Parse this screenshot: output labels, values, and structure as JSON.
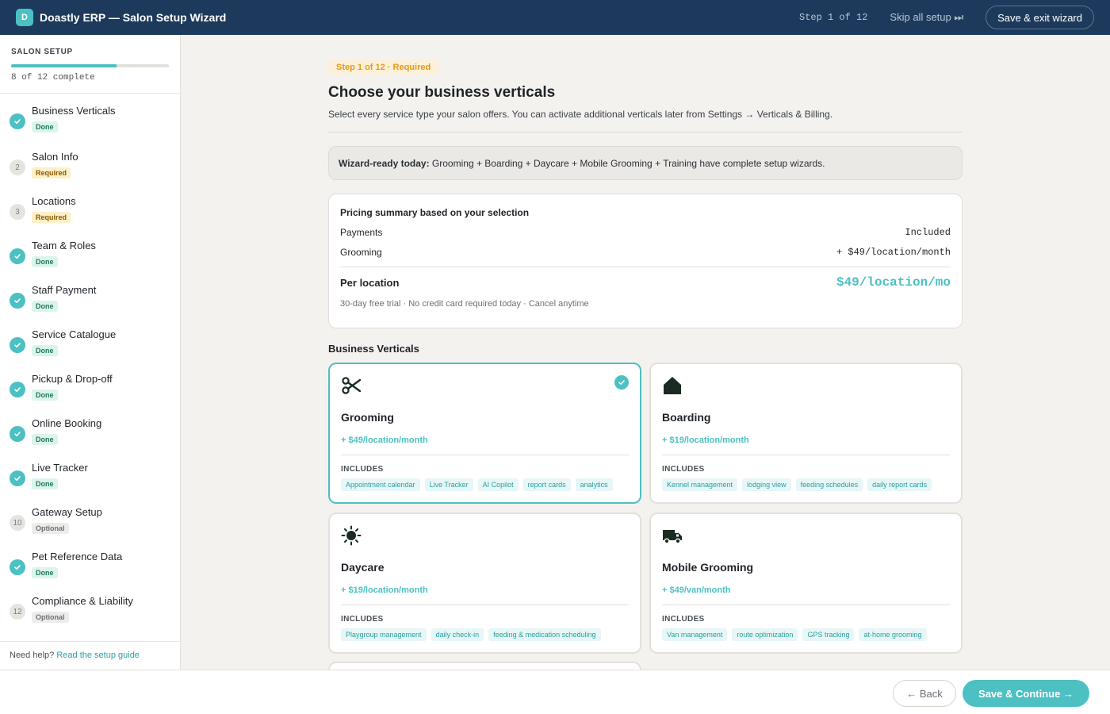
{
  "app": {
    "logo_letter": "D",
    "title": "Doastly ERP — Salon Setup Wizard",
    "step_indicator": "Step 1 of 12",
    "skip_label": "Skip all setup ⏭",
    "exit_label": "Save & exit wizard"
  },
  "sidebar": {
    "title": "SALON SETUP",
    "progress_fraction": 0.67,
    "progress_text": "8 of 12 complete",
    "items": [
      {
        "number": "1",
        "label": "Business Verticals",
        "status": "Done",
        "state": "done"
      },
      {
        "number": "2",
        "label": "Salon Info",
        "status": "Required",
        "state": "required"
      },
      {
        "number": "3",
        "label": "Locations",
        "status": "Required",
        "state": "required"
      },
      {
        "number": "4",
        "label": "Team & Roles",
        "status": "Done",
        "state": "done"
      },
      {
        "number": "5",
        "label": "Staff Payment",
        "status": "Done",
        "state": "done"
      },
      {
        "number": "6",
        "label": "Service Catalogue",
        "status": "Done",
        "state": "done"
      },
      {
        "number": "7",
        "label": "Pickup & Drop-off",
        "status": "Done",
        "state": "done"
      },
      {
        "number": "8",
        "label": "Online Booking",
        "status": "Done",
        "state": "done"
      },
      {
        "number": "9",
        "label": "Live Tracker",
        "status": "Done",
        "state": "done"
      },
      {
        "number": "10",
        "label": "Gateway Setup",
        "status": "Optional",
        "state": "optional"
      },
      {
        "number": "11",
        "label": "Pet Reference Data",
        "status": "Done",
        "state": "done"
      },
      {
        "number": "12",
        "label": "Compliance & Liability",
        "status": "Optional",
        "state": "optional"
      }
    ],
    "help_text": "Need help?",
    "help_link": "Read the setup guide"
  },
  "main": {
    "step_pill": "Step 1 of 12 · Required",
    "title": "Choose your business verticals",
    "subtitle": "Select every service type your salon offers. You can activate additional verticals later from Settings → Verticals & Billing.",
    "notice_bold": "Wizard-ready today:",
    "notice_text": " Grooming + Boarding + Daycare + Mobile Grooming + Training have complete setup wizards.",
    "pricing": {
      "title": "Pricing summary based on your selection",
      "rows": [
        {
          "label": "Payments",
          "value": "Included"
        },
        {
          "label": "Grooming",
          "value": "+ $49/location/month"
        }
      ],
      "total_label": "Per location",
      "total_value": "$49/location/mo",
      "note": "30-day free trial · No credit card required today · Cancel anytime"
    },
    "verticals_title": "Business Verticals",
    "includes_label": "INCLUDES",
    "verticals": [
      {
        "name": "Grooming",
        "price": "+ $49/location/month",
        "icon": "scissors-icon",
        "selected": true,
        "tags": [
          "Appointment calendar",
          "Live Tracker",
          "AI Copilot",
          "report cards",
          "analytics"
        ]
      },
      {
        "name": "Boarding",
        "price": "+ $19/location/month",
        "icon": "house-icon",
        "selected": false,
        "tags": [
          "Kennel management",
          "lodging view",
          "feeding schedules",
          "daily report cards"
        ]
      },
      {
        "name": "Daycare",
        "price": "+ $19/location/month",
        "icon": "sun-icon",
        "selected": false,
        "tags": [
          "Playgroup management",
          "daily check-in",
          "feeding & medication scheduling"
        ]
      },
      {
        "name": "Mobile Grooming",
        "price": "+ $49/van/month",
        "icon": "van-icon",
        "selected": false,
        "tags": [
          "Van management",
          "route optimization",
          "GPS tracking",
          "at-home grooming"
        ]
      }
    ]
  },
  "footer": {
    "back_label": "← Back",
    "continue_label": "Save & Continue →"
  },
  "colors": {
    "navy": "#1d3a5c",
    "teal": "#4cc0c2",
    "amber": "#e59a17"
  }
}
